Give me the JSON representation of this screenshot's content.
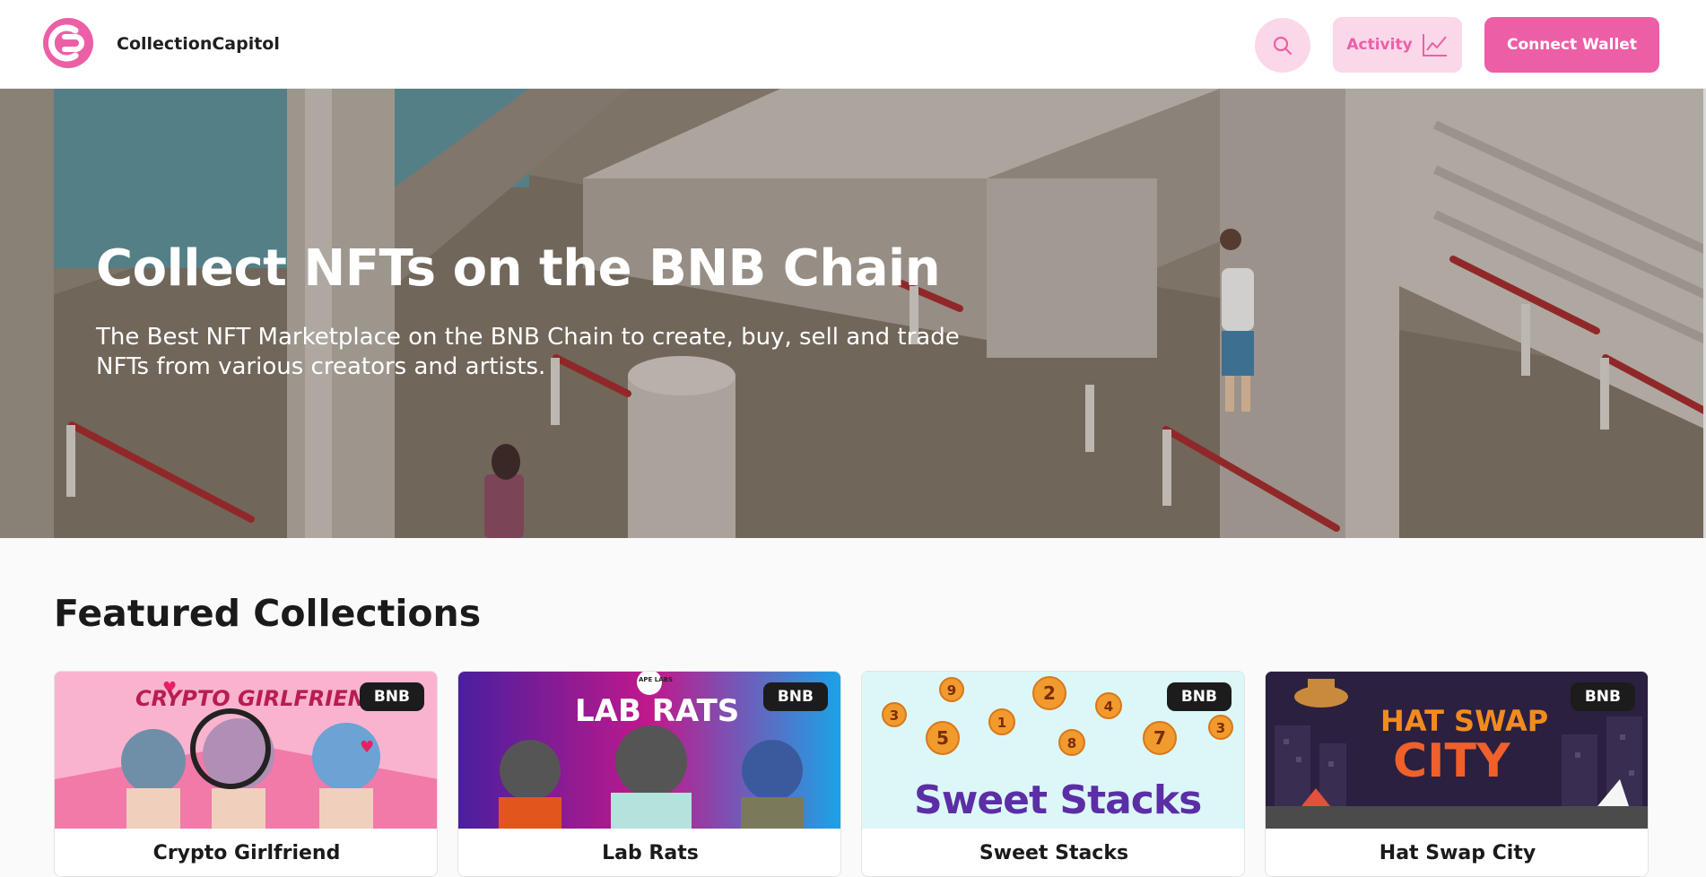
{
  "header": {
    "brand": "CollectionCapitol",
    "activity_label": "Activity",
    "connect_label": "Connect Wallet"
  },
  "hero": {
    "title": "Collect NFTs on the BNB Chain",
    "subtitle": "The Best NFT Marketplace on the BNB Chain to create, buy, sell and trade NFTs from various creators and artists."
  },
  "featured": {
    "title": "Featured Collections",
    "collections": [
      {
        "name": "Crypto Girlfriend",
        "chain": "BNB",
        "art_text": "CRYPTO GIRLFRIEND"
      },
      {
        "name": "Lab Rats",
        "chain": "BNB",
        "art_text": "LAB RATS",
        "art_small": "APE LABS"
      },
      {
        "name": "Sweet Stacks",
        "chain": "BNB",
        "art_text": "Sweet Stacks"
      },
      {
        "name": "Hat Swap City",
        "chain": "BNB",
        "art_text": "HAT SWAP",
        "art_text2": "CITY"
      }
    ]
  },
  "colors": {
    "accent": "#ec5fa6",
    "accent_soft": "#fbd7ea",
    "badge": "#1c1c1c"
  },
  "icons": [
    "logo-icon",
    "search-icon",
    "chart-line-icon"
  ]
}
